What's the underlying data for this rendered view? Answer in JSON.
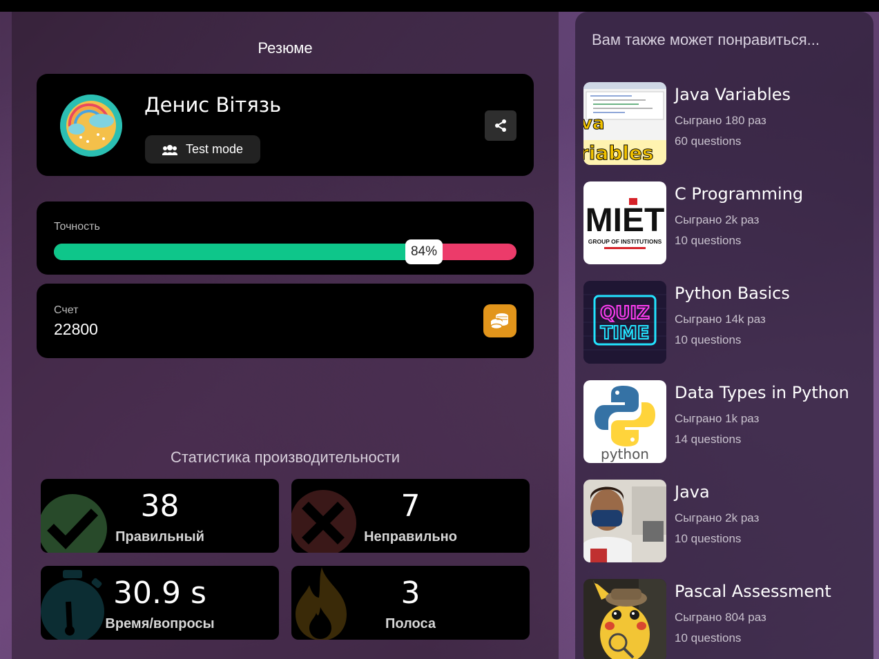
{
  "summary": {
    "title": "Резюме",
    "player_name": "Денис Вітязь",
    "mode_label": "Test mode"
  },
  "accuracy": {
    "label": "Точность",
    "percent_label": "84%",
    "percent": 84
  },
  "score": {
    "label": "Счет",
    "value": "22800"
  },
  "performance": {
    "title": "Статистика производительности",
    "stats": [
      {
        "value": "38",
        "label": "Правильный",
        "icon": "check-icon"
      },
      {
        "value": "7",
        "label": "Неправильно",
        "icon": "cross-icon"
      },
      {
        "value": "30.9 s",
        "label": "Время/вопросы",
        "icon": "timer-icon"
      },
      {
        "value": "3",
        "label": "Полоса",
        "icon": "flame-icon"
      }
    ]
  },
  "recommendations": {
    "title": "Вам также может понравиться...",
    "items": [
      {
        "title": "Java Variables",
        "plays": "Сыграно 180 раз",
        "questions": "60 questions",
        "thumb": "java-variables-thumb"
      },
      {
        "title": "C Programming",
        "plays": "Сыграно 2k раз",
        "questions": "10 questions",
        "thumb": "miet-logo-thumb",
        "thumb_text": "MIET",
        "thumb_caption": "GROUP OF INSTITUTIONS"
      },
      {
        "title": "Python Basics",
        "plays": "Сыграно 14k раз",
        "questions": "10 questions",
        "thumb": "quiz-time-thumb",
        "thumb_text_1": "QUIZ",
        "thumb_text_2": "TIME"
      },
      {
        "title": "Data Types in Python",
        "plays": "Сыграно 1k раз",
        "questions": "14 questions",
        "thumb": "python-logo-thumb",
        "thumb_text": "python"
      },
      {
        "title": "Java",
        "plays": "Сыграно 2k раз",
        "questions": "10 questions",
        "thumb": "person-photo-thumb"
      },
      {
        "title": "Pascal Assessment",
        "plays": "Сыграно 804 раз",
        "questions": "10 questions",
        "thumb": "pikachu-thumb"
      }
    ]
  },
  "colors": {
    "correct": "#0ec68a",
    "incorrect": "#ec3b6a",
    "coin": "#e2951b"
  }
}
